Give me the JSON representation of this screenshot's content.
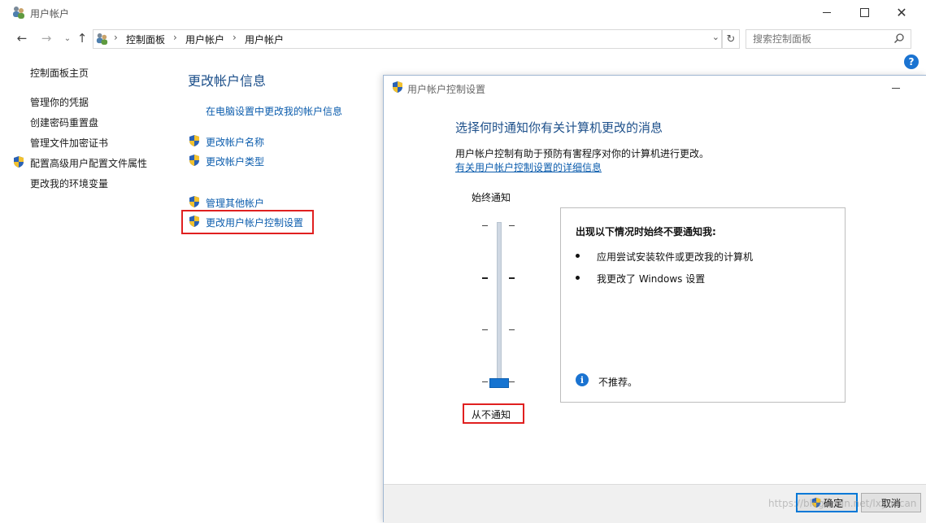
{
  "window": {
    "title": "用户帐户",
    "icon": "users-icon"
  },
  "navigation": {
    "breadcrumbs": [
      "控制面板",
      "用户帐户",
      "用户帐户"
    ],
    "search_placeholder": "搜索控制面板"
  },
  "sidebar": {
    "items": [
      {
        "label": "控制面板主页",
        "has_shield": false
      },
      {
        "label": "管理你的凭据",
        "has_shield": false
      },
      {
        "label": "创建密码重置盘",
        "has_shield": false
      },
      {
        "label": "管理文件加密证书",
        "has_shield": false
      },
      {
        "label": "配置高级用户配置文件属性",
        "has_shield": true
      },
      {
        "label": "更改我的环境变量",
        "has_shield": false
      }
    ]
  },
  "content": {
    "title": "更改帐户信息",
    "pc_settings_link": "在电脑设置中更改我的帐户信息",
    "links": [
      {
        "label": "更改帐户名称",
        "icon": "uac-shield-icon"
      },
      {
        "label": "更改帐户类型",
        "icon": "uac-shield-icon"
      },
      {
        "label": "管理其他帐户",
        "icon": "uac-shield-icon"
      },
      {
        "label": "更改用户帐户控制设置",
        "icon": "uac-shield-icon",
        "highlighted": true
      }
    ]
  },
  "uac_dialog": {
    "title": "用户帐户控制设置",
    "heading": "选择何时通知你有关计算机更改的消息",
    "description": "用户帐户控制有助于预防有害程序对你的计算机进行更改。",
    "details_link": "有关用户帐户控制设置的详细信息",
    "slider": {
      "top_label": "始终通知",
      "bottom_label": "从不通知",
      "levels": 4,
      "selected_level": 1
    },
    "info": {
      "title": "出现以下情况时始终不要通知我:",
      "bullets": [
        "应用尝试安装软件或更改我的计算机",
        "我更改了 Windows 设置"
      ],
      "note": "不推荐。"
    },
    "buttons": {
      "ok": "确定",
      "cancel": "取消"
    }
  },
  "colors": {
    "link": "#0b5cad",
    "heading": "#1c4f8a",
    "highlight_box": "#e02020",
    "slider_thumb": "#1674d1"
  },
  "watermark": "https://blog.csdn.net/lxyoucan"
}
